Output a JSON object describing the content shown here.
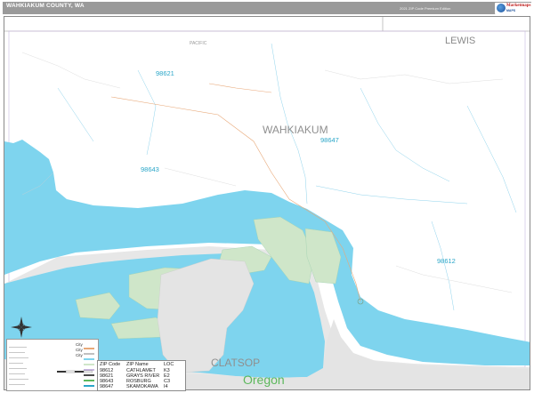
{
  "header": {
    "title": "WAHKIAKUM COUNTY, WA",
    "edition": "2021 ZIP Code Premium Edition",
    "logo_text": "Marketmaps",
    "logo_sub": "MAPS"
  },
  "map": {
    "county_label": "WAHKIAKUM",
    "neighbors": {
      "north_west": "PACIFIC",
      "north_east": "LEWIS",
      "south": "CLATSOP",
      "state_south": "Oregon"
    },
    "zip_labels": [
      "98621",
      "98647",
      "98643",
      "98612"
    ],
    "colors": {
      "water": "#7ed4ee",
      "land_oregon": "#e6e6e6",
      "island_green": "#cfe6c9",
      "zip_text": "#2aa6c8",
      "header_bar": "#9a9a9a",
      "oregon_text": "#5cb85c"
    }
  },
  "legend": {
    "city_key": [
      "City",
      "City",
      "City"
    ]
  },
  "zip_table": {
    "headers": [
      "ZIP Code",
      "ZIP Name",
      "LOC"
    ],
    "rows": [
      [
        "98612",
        "CATHLAMET",
        "K3"
      ],
      [
        "98621",
        "GRAYS RIVER",
        "E2"
      ],
      [
        "98643",
        "ROSBURG",
        "C3"
      ],
      [
        "98647",
        "SKAMOKAWA",
        "I4"
      ]
    ]
  }
}
